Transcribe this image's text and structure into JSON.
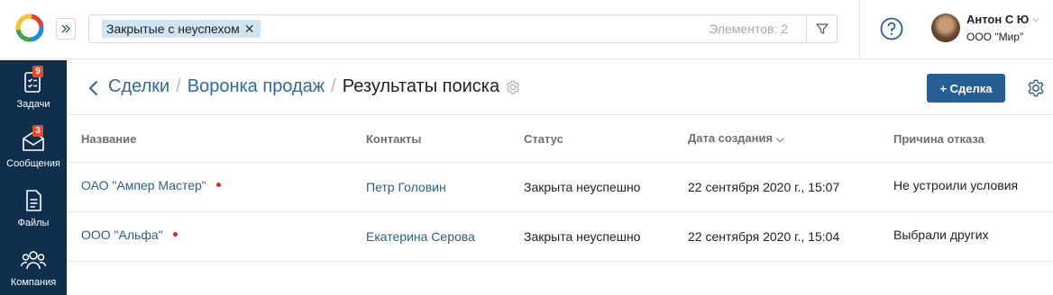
{
  "colors": {
    "accent": "#255f95",
    "sidebar": "#0f2f4d",
    "badge": "#e24a2b",
    "link": "#2c5e8f",
    "chip": "#cfe4f4"
  },
  "search": {
    "filter_chip": "Закрытые с неуспехом",
    "count_label": "Элементов: 2"
  },
  "user": {
    "name": "Антон С Ю",
    "company": "ООО \"Мир\""
  },
  "sidebar": {
    "items": [
      {
        "label": "Задачи",
        "badge": "9",
        "icon": "tasks-icon"
      },
      {
        "label": "Сообщения",
        "badge": "3",
        "icon": "messages-icon"
      },
      {
        "label": "Файлы",
        "badge": "",
        "icon": "files-icon"
      },
      {
        "label": "Компания",
        "badge": "",
        "icon": "company-icon"
      }
    ]
  },
  "breadcrumb": {
    "root": "Сделки",
    "funnel": "Воронка продаж",
    "current": "Результаты поиска"
  },
  "toolbar": {
    "add_label": "+ Сделка"
  },
  "table": {
    "columns": [
      "Название",
      "Контакты",
      "Статус",
      "Дата создания",
      "Причина отказа"
    ],
    "rows": [
      {
        "name": "ОАО \"Ампер Мастер\"",
        "contact": "Петр Головин",
        "status": "Закрыта неуспешно",
        "created": "22 сентября 2020 г., 15:07",
        "reason": "Не устроили условия"
      },
      {
        "name": "ООО \"Альфа\"",
        "contact": "Екатерина Серова",
        "status": "Закрыта неуспешно",
        "created": "22 сентября 2020 г., 15:04",
        "reason": "Выбрали других"
      }
    ]
  }
}
